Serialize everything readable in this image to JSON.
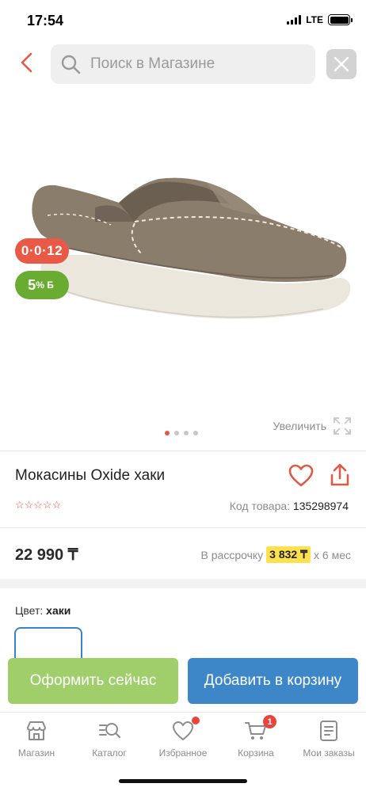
{
  "status_bar": {
    "time": "17:54",
    "network": "LTE"
  },
  "search": {
    "placeholder": "Поиск в Магазине"
  },
  "gallery": {
    "timer_badge": "0·0·12",
    "bonus_badge_value": "5",
    "bonus_badge_unit": "% Б",
    "zoom_label": "Увеличить",
    "slide_count": 4,
    "active_slide": 1
  },
  "product": {
    "title": "Мокасины Oxide хаки",
    "rating_stars": "☆☆☆☆☆",
    "code_label": "Код товара:",
    "code_value": "135298974",
    "price": "22 990 ₸",
    "installment_prefix": "В рассрочку",
    "installment_amount": "3 832 ₸",
    "installment_suffix": "x 6 мес",
    "color_label": "Цвет:",
    "color_value": "хаки"
  },
  "actions": {
    "buy_now": "Оформить сейчас",
    "add_to_cart": "Добавить в корзину"
  },
  "tabbar": {
    "items": [
      {
        "label": "Магазин",
        "icon": "shop-icon"
      },
      {
        "label": "Каталог",
        "icon": "catalog-search-icon"
      },
      {
        "label": "Избранное",
        "icon": "heart-icon"
      },
      {
        "label": "Корзина",
        "icon": "cart-icon",
        "badge": "1"
      },
      {
        "label": "Мои заказы",
        "icon": "orders-icon"
      }
    ]
  },
  "colors": {
    "accent_red": "#e05a45",
    "bonus_green": "#6aab31",
    "buy_green": "#9fce6b",
    "cart_blue": "#3d87c9",
    "installment_yellow": "#ffe14d"
  }
}
